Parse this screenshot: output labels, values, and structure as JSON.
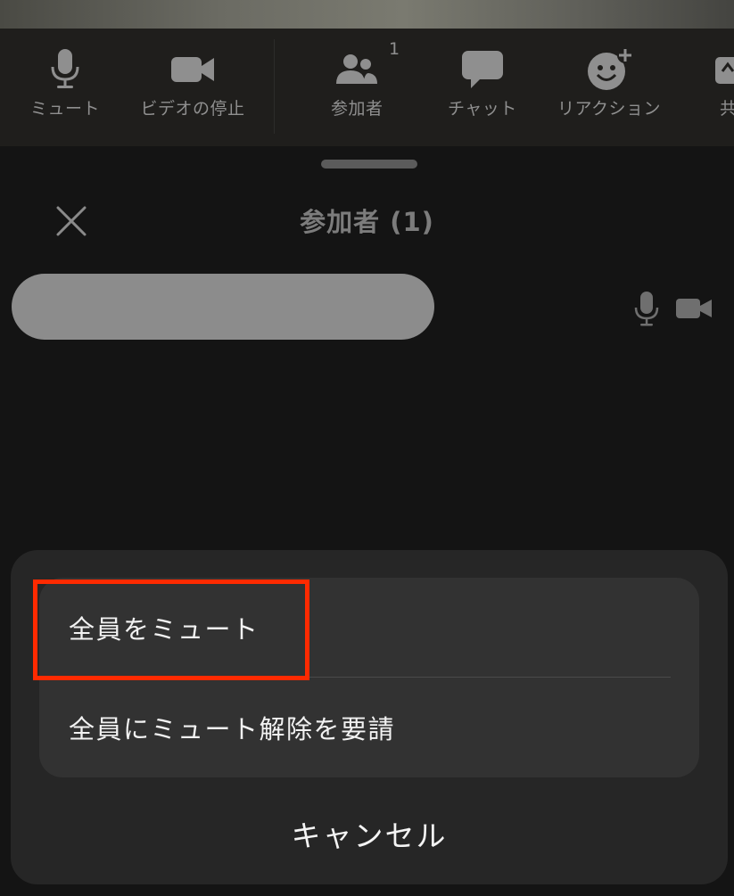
{
  "toolbar": {
    "items": [
      {
        "label": "ミュート",
        "icon": "microphone-icon"
      },
      {
        "label": "ビデオの停止",
        "icon": "video-camera-icon"
      },
      {
        "label": "参加者",
        "icon": "participants-icon",
        "badge": "1"
      },
      {
        "label": "チャット",
        "icon": "chat-bubble-icon"
      },
      {
        "label": "リアクション",
        "icon": "reaction-smiley-icon"
      },
      {
        "label": "共",
        "icon": "share-icon"
      }
    ]
  },
  "panel": {
    "title": "参加者 (1)",
    "close_icon": "close-icon",
    "participant": {
      "mic_icon": "microphone-icon",
      "camera_icon": "video-camera-icon"
    }
  },
  "action_sheet": {
    "items": [
      {
        "label": "全員をミュート"
      },
      {
        "label": "全員にミュート解除を要請"
      }
    ],
    "cancel_label": "キャンセル",
    "highlight_color": "#ff2a00"
  },
  "colors": {
    "background": "#141414",
    "toolbar_bg": "#1f1e1c",
    "sheet_bg": "#262626",
    "sheet_group_bg": "#323232",
    "muted_text": "#8f8f8f"
  }
}
